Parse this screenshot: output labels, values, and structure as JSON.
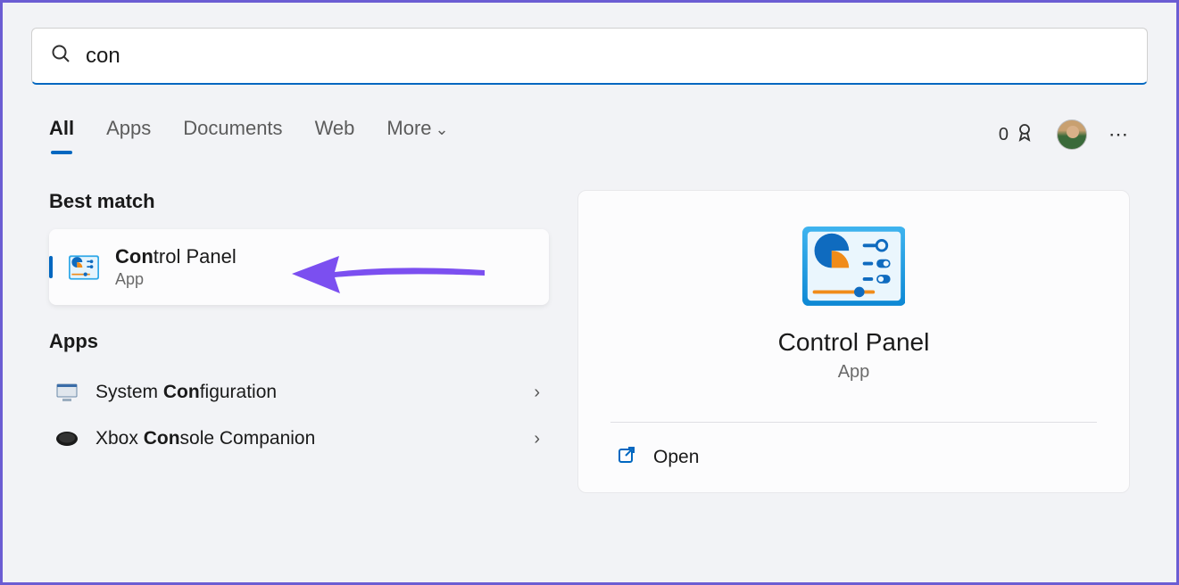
{
  "search": {
    "query": "con"
  },
  "tabs": {
    "all": "All",
    "apps": "Apps",
    "documents": "Documents",
    "web": "Web",
    "more": "More"
  },
  "topbar": {
    "rewards_count": "0"
  },
  "left": {
    "best_match_header": "Best match",
    "best_match": {
      "title_bold": "Con",
      "title_rest": "trol Panel",
      "subtitle": "App"
    },
    "apps_header": "Apps",
    "apps": [
      {
        "pre": "System ",
        "bold": "Con",
        "post": "figuration"
      },
      {
        "pre": "Xbox ",
        "bold": "Con",
        "post": "sole Companion"
      }
    ]
  },
  "right": {
    "title": "Control Panel",
    "subtitle": "App",
    "open_label": "Open"
  }
}
